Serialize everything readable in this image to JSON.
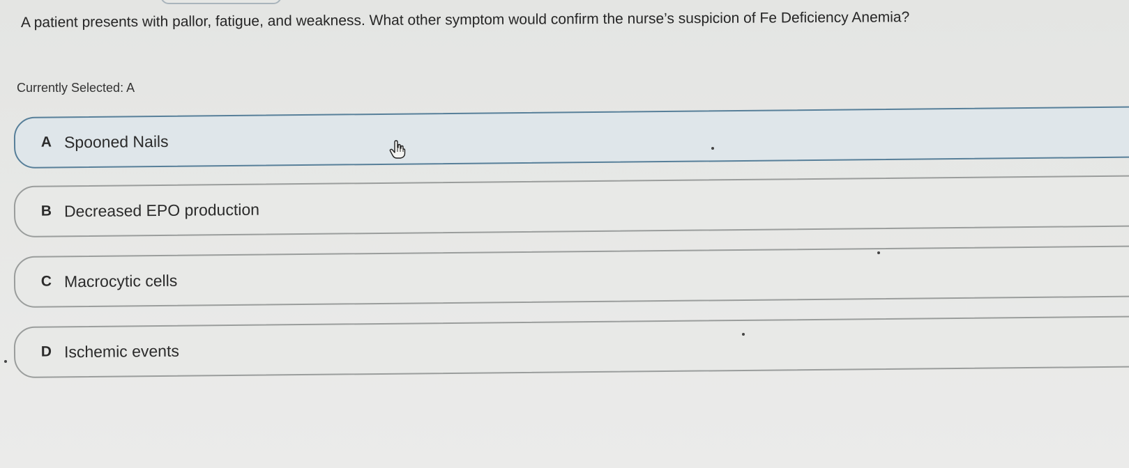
{
  "question": {
    "text": "A patient presents with pallor, fatigue, and weakness. What other symptom would confirm the nurse’s suspicion of Fe Deficiency Anemia?"
  },
  "selection": {
    "label": "Currently Selected: A"
  },
  "options": [
    {
      "letter": "A",
      "text": "Spooned Nails",
      "selected": true
    },
    {
      "letter": "B",
      "text": "Decreased EPO production",
      "selected": false
    },
    {
      "letter": "C",
      "text": "Macrocytic cells",
      "selected": false
    },
    {
      "letter": "D",
      "text": "Ischemic events",
      "selected": false
    }
  ],
  "icons": {
    "cursor": "hand-pointer-icon"
  },
  "colors": {
    "selected_border": "#577f99",
    "selected_background": "#dfe6ea",
    "option_border": "#9a9d9c",
    "background": "#e7e8e6"
  }
}
